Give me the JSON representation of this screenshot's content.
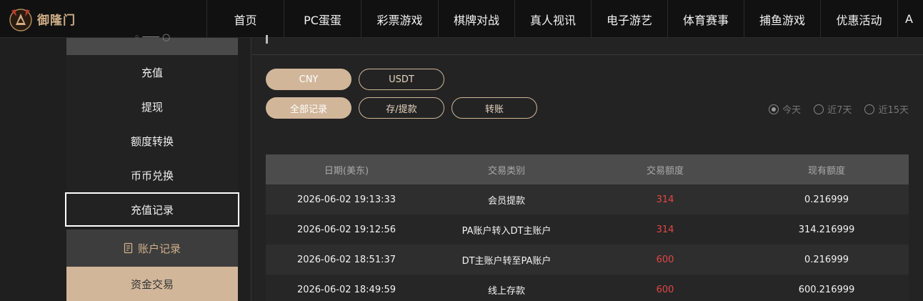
{
  "brand": {
    "logo_text": "御隆门"
  },
  "nav": {
    "items": [
      "首页",
      "PC蛋蛋",
      "彩票游戏",
      "棋牌对战",
      "真人视讯",
      "电子游艺",
      "体育赛事",
      "捕鱼游戏",
      "优惠活动",
      "A"
    ]
  },
  "sidebar": {
    "items": [
      "充值",
      "提现",
      "额度转换",
      "币币兑换",
      "充值记录"
    ],
    "active_index": 4,
    "section_label": "账户记录",
    "selected_label": "资金交易"
  },
  "currency_tabs": {
    "cny": "CNY",
    "usdt": "USDT",
    "selected": "CNY"
  },
  "record_tabs": {
    "all": "全部记录",
    "deposit_withdraw": "存/提款",
    "transfer": "转账",
    "selected": "全部记录"
  },
  "date_filter": {
    "today": "今天",
    "last7": "近7天",
    "last15": "近15天",
    "selected": "今天"
  },
  "table": {
    "headers": [
      "日期(美东)",
      "交易类别",
      "交易额度",
      "现有额度"
    ],
    "rows": [
      {
        "date": "2026-06-02 19:13:33",
        "type": "会员提款",
        "amount": "314",
        "balance": "0.216999"
      },
      {
        "date": "2026-06-02 19:12:56",
        "type": "PA账户转入DT主账户",
        "amount": "314",
        "balance": "314.216999"
      },
      {
        "date": "2026-06-02 18:51:37",
        "type": "DT主账户转至PA账户",
        "amount": "600",
        "balance": "0.216999"
      },
      {
        "date": "2026-06-02 18:49:59",
        "type": "线上存款",
        "amount": "600",
        "balance": "600.216999"
      }
    ]
  },
  "colors": {
    "accent": "#d1b69a",
    "amount_red": "#e54545",
    "header_gray": "#4c4c4c"
  }
}
